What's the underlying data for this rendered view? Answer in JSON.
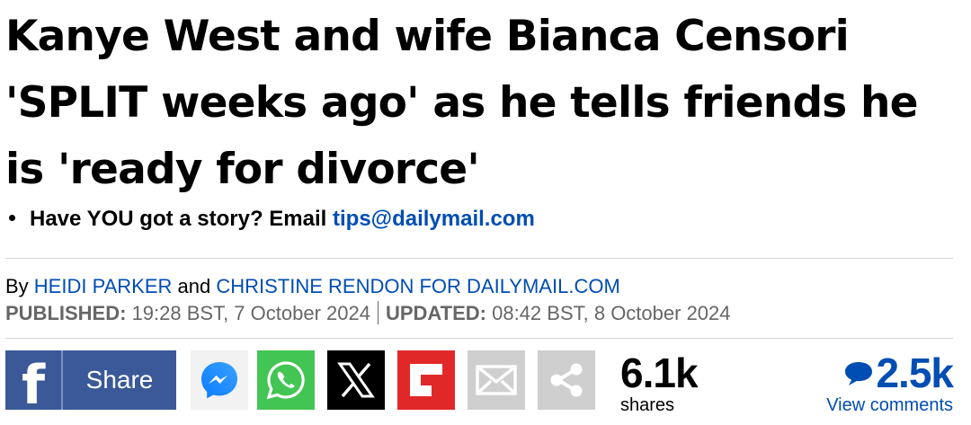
{
  "headline": "Kanye West and wife Bianca Censori 'SPLIT weeks ago' as he tells friends he is 'ready for divorce'",
  "tip": {
    "text": "Have YOU got a story? Email ",
    "email": "tips@dailymail.com"
  },
  "byline": {
    "by": "By ",
    "author1": "HEIDI PARKER",
    "and": " and ",
    "author2": "CHRISTINE RENDON FOR DAILYMAIL.COM"
  },
  "dates": {
    "published_label": "PUBLISHED:",
    "published_value": " 19:28 BST, 7 October 2024",
    "updated_label": "UPDATED:",
    "updated_value": " 08:42 BST, 8 October 2024"
  },
  "share": {
    "facebook_letter": "f",
    "facebook_label": "Share",
    "icons": [
      "messenger-icon",
      "whatsapp-icon",
      "x-icon",
      "flipboard-icon",
      "email-icon",
      "share-icon"
    ]
  },
  "stats": {
    "shares_count": "6.1k",
    "shares_label": "shares",
    "comments_count": "2.5k",
    "comments_label": "View comments"
  },
  "colors": {
    "link": "#004db3",
    "facebook": "#3b5998",
    "whatsapp": "#43c553",
    "flipboard": "#e12828",
    "grey_button": "#cfcfcf"
  }
}
